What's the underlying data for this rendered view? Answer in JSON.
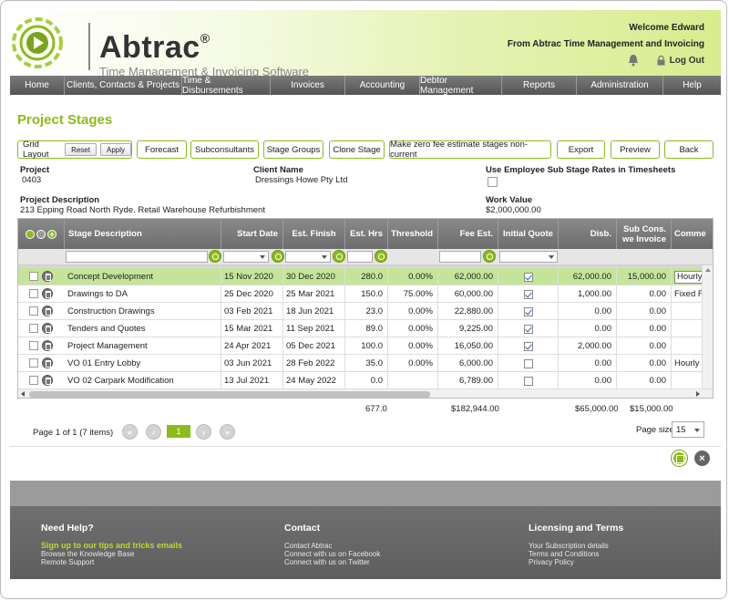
{
  "header": {
    "brand": "Abtrac",
    "brand_mark": "®",
    "tagline": "Time Management & Invoicing Software",
    "welcome": "Welcome Edward",
    "company": "From Abtrac Time Management and Invoicing",
    "logout": "Log Out"
  },
  "nav": [
    "Home",
    "Clients, Contacts & Projects",
    "Time & Disbursements",
    "Invoices",
    "Accounting",
    "Debtor Management",
    "Reports",
    "Administration",
    "Help"
  ],
  "page_title": "Project Stages",
  "toolbar": {
    "grid_layout": "Grid Layout",
    "reset": "Reset",
    "apply": "Apply",
    "forecast": "Forecast",
    "subconsultants": "Subconsultants",
    "stage_groups": "Stage Groups",
    "clone_stage": "Clone Stage",
    "make_zero": "Make zero fee estimate stages non-current",
    "export": "Export",
    "preview": "Preview",
    "back": "Back"
  },
  "info": {
    "project_label": "Project",
    "project_value": "0403",
    "client_label": "Client Name",
    "client_value": "Dressings Howe Pty Ltd",
    "use_employee_label": "Use Employee Sub Stage Rates in Timesheets",
    "use_employee_checked": false,
    "desc_label": "Project Description",
    "desc_value": "213 Epping Road North Ryde. Retail Warehouse Refurbishment",
    "work_label": "Work Value",
    "work_value": "$2,000,000.00"
  },
  "grid": {
    "columns": {
      "stage": "Stage Description",
      "start": "Start Date",
      "finish": "Est. Finish",
      "hrs": "Est. Hrs",
      "threshold": "Threshold",
      "fee": "Fee Est.",
      "quote": "Initial Quote",
      "disb": "Disb.",
      "subcons_1": "Sub Cons.",
      "subcons_2": "we Invoice",
      "comment": "Comme"
    },
    "rows": [
      {
        "stage": "Concept Development",
        "start": "15 Nov 2020",
        "finish": "30 Dec 2020",
        "hrs": "280.0",
        "threshold": "0.00%",
        "fee": "62,000.00",
        "quote": true,
        "disb": "62,000.00",
        "subcons": "15,000.00",
        "comment": "Hourly"
      },
      {
        "stage": "Drawings to DA",
        "start": "25 Dec 2020",
        "finish": "25 Mar 2021",
        "hrs": "150.0",
        "threshold": "75.00%",
        "fee": "60,000.00",
        "quote": true,
        "disb": "1,000.00",
        "subcons": "0.00",
        "comment": "Fixed Fe"
      },
      {
        "stage": "Construction Drawings",
        "start": "03 Feb 2021",
        "finish": "18 Jun 2021",
        "hrs": "23.0",
        "threshold": "0.00%",
        "fee": "22,880.00",
        "quote": true,
        "disb": "0.00",
        "subcons": "0.00",
        "comment": ""
      },
      {
        "stage": "Tenders and Quotes",
        "start": "15 Mar 2021",
        "finish": "11 Sep 2021",
        "hrs": "89.0",
        "threshold": "0.00%",
        "fee": "9,225.00",
        "quote": true,
        "disb": "0.00",
        "subcons": "0.00",
        "comment": ""
      },
      {
        "stage": "Project Management",
        "start": "24 Apr 2021",
        "finish": "05 Dec 2021",
        "hrs": "100.0",
        "threshold": "0.00%",
        "fee": "16,050.00",
        "quote": true,
        "disb": "2,000.00",
        "subcons": "0.00",
        "comment": ""
      },
      {
        "stage": "VO 01 Entry Lobby",
        "start": "03 Jun 2021",
        "finish": "28 Feb 2022",
        "hrs": "35.0",
        "threshold": "0.00%",
        "fee": "6,000.00",
        "quote": false,
        "disb": "0.00",
        "subcons": "0.00",
        "comment": "Hourly r"
      },
      {
        "stage": "VO 02 Carpark Modification",
        "start": "13 Jul 2021",
        "finish": "24 May 2022",
        "hrs": "0.0",
        "threshold": "",
        "fee": "6,789.00",
        "quote": false,
        "disb": "0.00",
        "subcons": "0.00",
        "comment": ""
      }
    ],
    "totals": {
      "hrs": "677.0",
      "fee": "$182,944.00",
      "disb": "$65,000.00",
      "subcons": "$15,000.00"
    }
  },
  "pager": {
    "text": "Page 1 of 1 (7 items)",
    "current": "1",
    "size_label": "Page size:",
    "size_value": "15"
  },
  "footer": {
    "help_title": "Need Help?",
    "help_links": [
      "Sign up to our tips and tricks emails",
      "Browse the Knowledge Base",
      "Remote Support"
    ],
    "contact_title": "Contact",
    "contact_links": [
      "Contact Abtrac",
      "Connect with us on Facebook",
      "Connect with us on Twitter"
    ],
    "licensing_title": "Licensing and Terms",
    "licensing_links": [
      "Your Subscription details",
      "Terms and Conditions",
      "Privacy Policy"
    ]
  },
  "colors": {
    "accent": "#8dbb1a",
    "nav": "#666666",
    "selected_row": "#c5e49a"
  }
}
